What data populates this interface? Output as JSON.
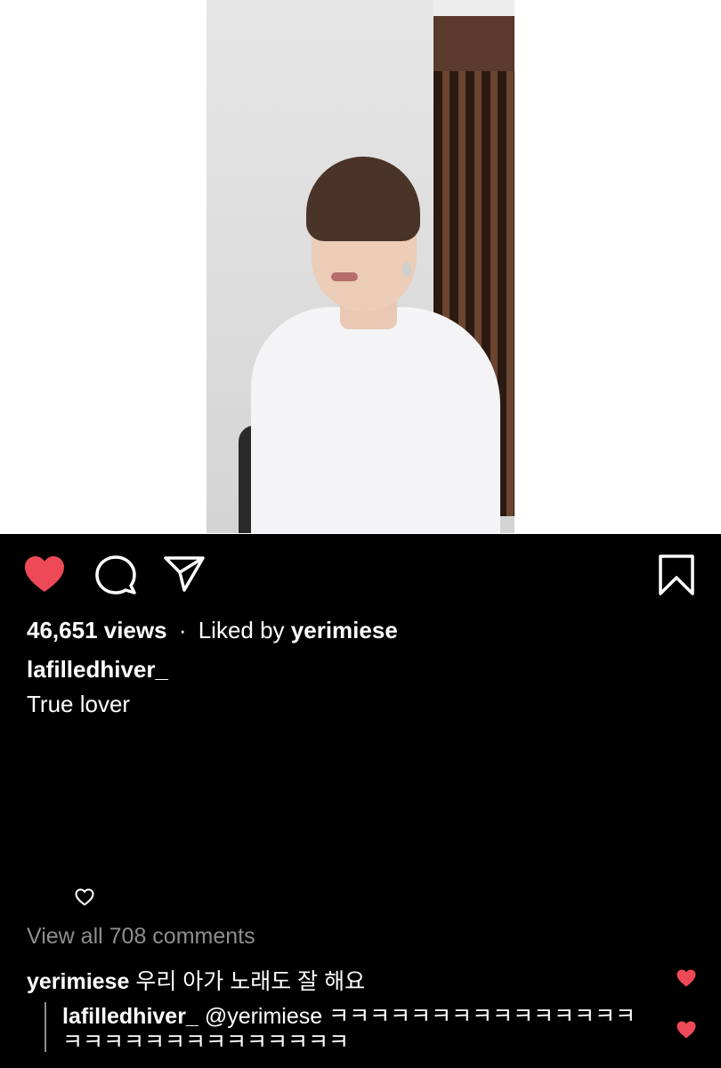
{
  "post": {
    "views": "46,651 views",
    "separator": "·",
    "liked_by_prefix": "Liked by",
    "liked_by_user": "yerimiese",
    "author": "lafilledhiver_",
    "caption": "True lover"
  },
  "comments": {
    "view_all": "View all 708 comments",
    "items": [
      {
        "user": "yerimiese",
        "text": "우리 아가 노래도 잘 해요",
        "liked": true
      },
      {
        "user": "lafilledhiver_",
        "text": "@yerimiese ㅋㅋㅋㅋㅋㅋㅋㅋㅋㅋㅋㅋㅋㅋㅋㅋㅋㅋㅋㅋㅋㅋㅋㅋㅋㅋㅋㅋㅋ",
        "liked": true
      }
    ]
  },
  "icons": {
    "like": "heart-icon",
    "comment": "comment-icon",
    "share": "paper-plane-icon",
    "save": "bookmark-icon"
  },
  "colors": {
    "liked_heart": "#ED4956",
    "muted_text": "#8E8E8E",
    "background": "#000000"
  }
}
